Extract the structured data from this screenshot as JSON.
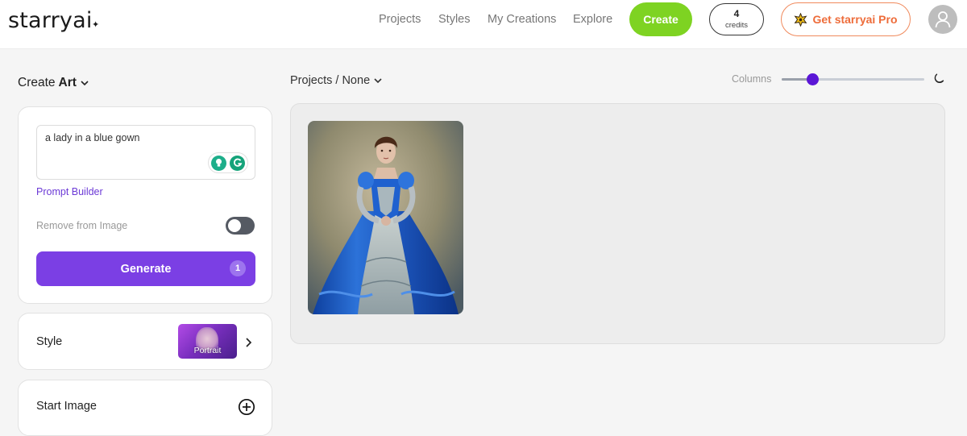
{
  "brand": {
    "name": "starryai",
    "spark": "✦"
  },
  "nav": {
    "links": [
      "Projects",
      "Styles",
      "My Creations",
      "Explore"
    ],
    "create_label": "Create",
    "credits": {
      "count": "4",
      "label": "credits"
    },
    "pro_label": "Get starryai Pro"
  },
  "left": {
    "mode_prefix": "Create",
    "mode": "Art",
    "prompt": {
      "value": "a lady in a blue gown"
    },
    "prompt_builder": "Prompt Builder",
    "remove_label": "Remove from Image",
    "remove_enabled": false,
    "generate": {
      "label": "Generate",
      "count": "1"
    },
    "style": {
      "label": "Style",
      "thumb_caption": "Portrait"
    },
    "start_image": {
      "label": "Start Image"
    }
  },
  "right": {
    "breadcrumb": "Projects / None",
    "columns_label": "Columns",
    "columns_level": 0.22,
    "gallery": [
      {
        "subject": "a lady in a blue gown"
      }
    ]
  },
  "colors": {
    "accent_green": "#7ed322",
    "accent_purple": "#7b3fe4",
    "pro_orange": "#ee6c3a",
    "slider_thumb": "#5b16d6"
  },
  "icons": [
    "sparkle-icon",
    "chevron-down-icon",
    "lightbulb-icon",
    "grammarly-icon",
    "chevron-right-icon",
    "plus-circle-icon",
    "moon-icon",
    "user-avatar-icon",
    "badge-star-icon"
  ]
}
